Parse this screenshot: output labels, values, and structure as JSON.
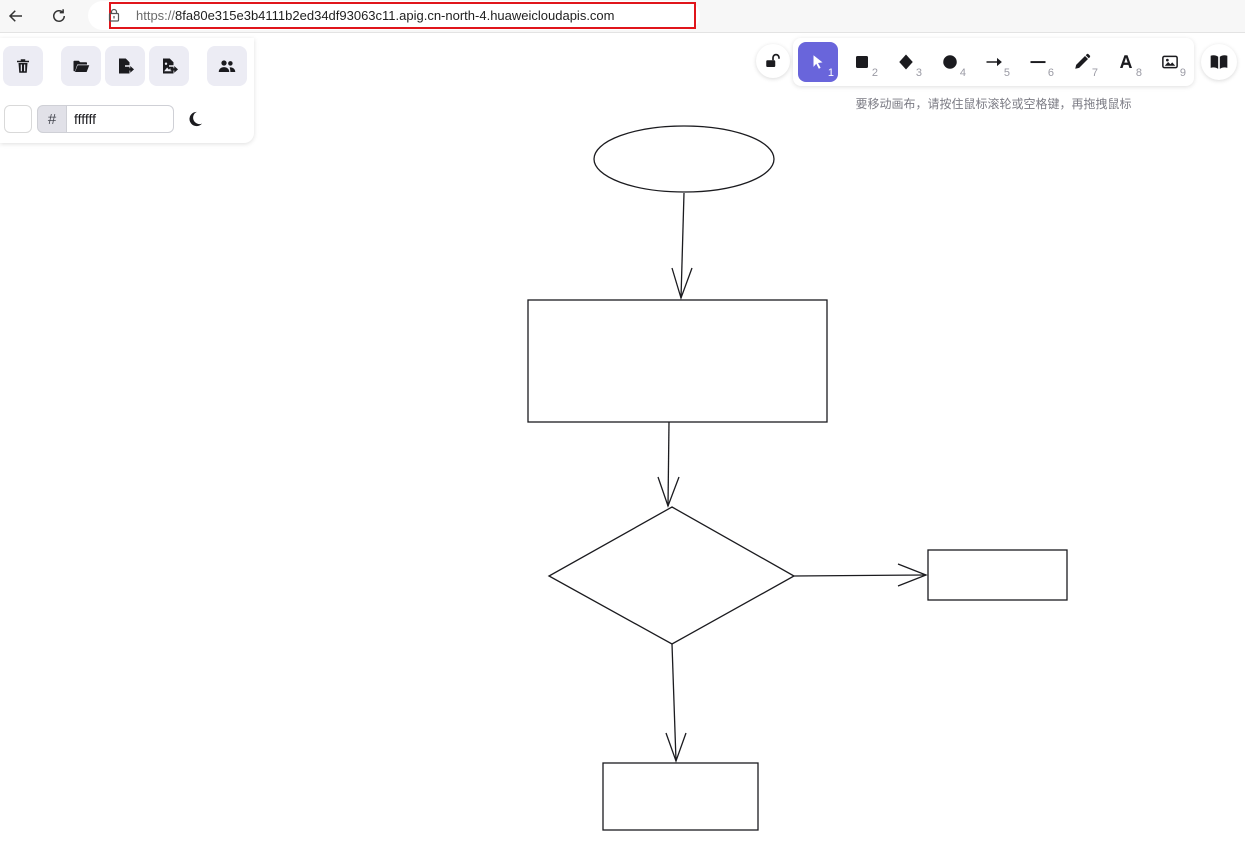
{
  "browser": {
    "url_scheme": "https://",
    "url_host": "8fa80e315e3b4111b2ed34df93063c11.apig.cn-north-4.huaweicloudapis.com"
  },
  "left_panel": {
    "tools": [
      "trash-icon",
      "folder-open-icon",
      "export-file-icon",
      "export-image-icon",
      "users-icon"
    ],
    "color_prefix": "#",
    "color_value": "ffffff"
  },
  "toolbar": {
    "tools": [
      {
        "name": "selection",
        "icon": "pointer-icon",
        "key": "1",
        "active": true
      },
      {
        "name": "rectangle",
        "icon": "square-icon",
        "key": "2"
      },
      {
        "name": "diamond",
        "icon": "diamond-icon",
        "key": "3"
      },
      {
        "name": "ellipse",
        "icon": "circle-icon",
        "key": "4"
      },
      {
        "name": "arrow",
        "icon": "arrow-icon",
        "key": "5"
      },
      {
        "name": "line",
        "icon": "line-icon",
        "key": "6"
      },
      {
        "name": "draw",
        "icon": "pencil-icon",
        "key": "7"
      },
      {
        "name": "text",
        "icon": "text-icon",
        "key": "8"
      },
      {
        "name": "image",
        "icon": "image-icon",
        "key": "9"
      }
    ],
    "hint": "要移动画布，请按住鼠标滚轮或空格键，再拖拽鼠标"
  },
  "colors": {
    "accent": "#6965db",
    "highlight": "#e0151b",
    "stroke": "#1b1b1f",
    "panel_bg": "#ececf4"
  }
}
